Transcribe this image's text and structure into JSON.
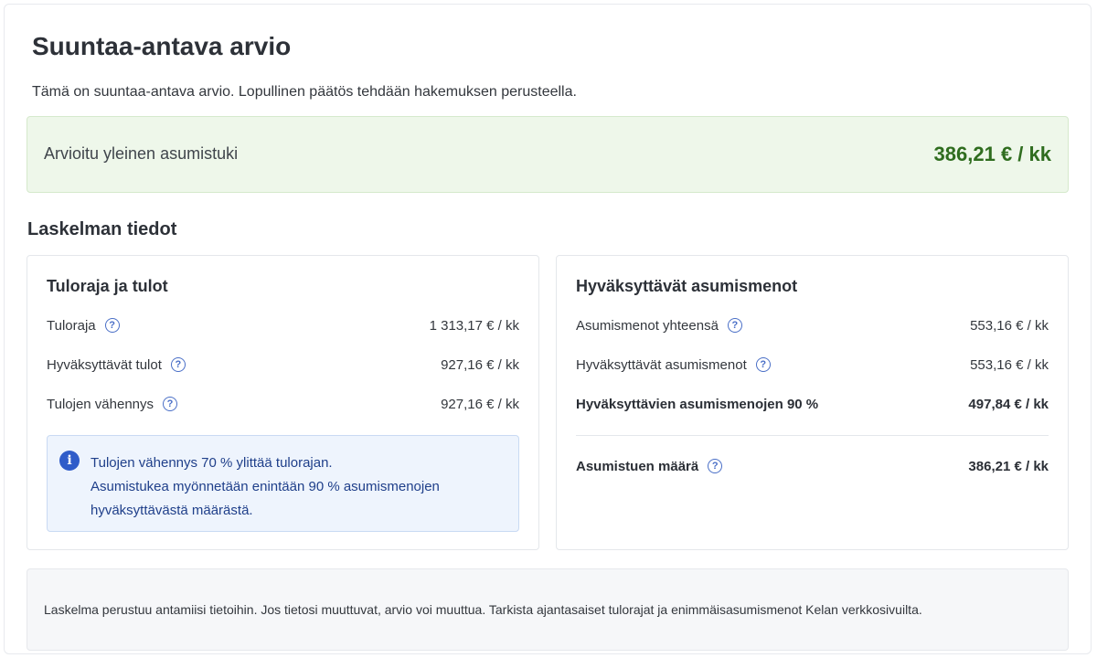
{
  "page": {
    "title": "Suuntaa-antava arvio",
    "subtitle": "Tämä on suuntaa-antava arvio. Lopullinen päätös tehdään hakemuksen perusteella."
  },
  "estimate": {
    "label": "Arvioitu yleinen asumistuki",
    "value": "386,21 € / kk",
    "accent_color": "#2f6d1f"
  },
  "details": {
    "heading": "Laskelman tiedot",
    "income_card": {
      "title": "Tuloraja ja tulot",
      "rows": [
        {
          "label": "Tuloraja",
          "value": "1 313,17 € / kk"
        },
        {
          "label": "Hyväksyttävät tulot",
          "value": "927,16 € / kk"
        },
        {
          "label": "Tulojen vähennys",
          "value": "927,16 € / kk"
        }
      ],
      "info": {
        "icon": "info-icon",
        "lines": [
          "Tulojen vähennys 70 % ylittää tulorajan.",
          "Asumistukea myönnetään enintään 90 % asumismenojen",
          "hyväksyttävästä määrästä."
        ]
      }
    },
    "housing_card": {
      "title": "Hyväksyttävät asumismenot",
      "rows": [
        {
          "label": "Asumismenot yhteensä",
          "value": "553,16 € / kk"
        },
        {
          "label": "Hyväksyttävät asumismenot",
          "value": "553,16 € / kk"
        },
        {
          "label": "Hyväksyttävien asumismenojen 90 %",
          "value": "497,84 € / kk"
        },
        {
          "label": "Asumistuen määrä",
          "value": "386,21 € / kk"
        }
      ]
    }
  },
  "footer": {
    "text": "Laskelma perustuu antamiisi tietoihin. Jos tietosi muuttuvat, arvio voi muuttua. Tarkista ajantasaiset tulorajat ja enimmäisasumismenot Kelan verkkosivuilta."
  },
  "help_icon": {
    "glyph": "?",
    "name": "help-icon"
  }
}
